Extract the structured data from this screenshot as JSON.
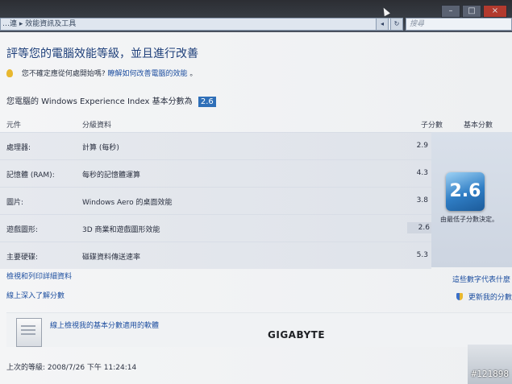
{
  "window": {
    "address": "…連 ▸ 效能資訊及工具",
    "search_placeholder": "搜尋",
    "min_label": "–",
    "max_label": "□",
    "close_label": "×",
    "back_label": "◂",
    "refresh_label": "↻"
  },
  "page": {
    "title": "評等您的電腦效能等級，並且進行改善",
    "tip_text": "您不確定應從何處開始嗎?",
    "tip_link": "瞭解如何改善電腦的效能",
    "tip_end": "。",
    "score_label": "您電腦的 Windows Experience Index 基本分數為",
    "score_value": "2.6"
  },
  "table": {
    "headers": {
      "component": "元件",
      "rating": "分級資料",
      "subscore": "子分數",
      "basescore": "基本分數"
    },
    "rows": [
      {
        "component": "處理器:",
        "description": "計算 (每秒)",
        "subscore": "2.9"
      },
      {
        "component": "記憶體 (RAM):",
        "description": "每秒的記憶體運算",
        "subscore": "4.3"
      },
      {
        "component": "圖片:",
        "description": "Windows Aero 的桌面效能",
        "subscore": "3.8"
      },
      {
        "component": "遊戲圖形:",
        "description": "3D 商業和遊戲圖形效能",
        "subscore": "2.6"
      },
      {
        "component": "主要硬碟:",
        "description": "磁碟資料傳送速率",
        "subscore": "5.3"
      }
    ],
    "base_badge": "2.6",
    "base_note": "由最低子分數決定。"
  },
  "links": {
    "view_details": "檢視和列印詳細資料",
    "learn_more": "線上深入了解分數",
    "what_numbers_mean": "這些數字代表什麼",
    "update_score": "更新我的分數"
  },
  "offer": {
    "text": "線上檢視我的基本分數適用的軟體"
  },
  "brand": "GIGABYTE",
  "last_update": "上次的等級: 2008/7/26 下午 11:24:14",
  "watermark": "#121898",
  "colors": {
    "title": "#1e3f7a",
    "link": "#1e4fa0",
    "score_chip": "#2f6fb8"
  }
}
